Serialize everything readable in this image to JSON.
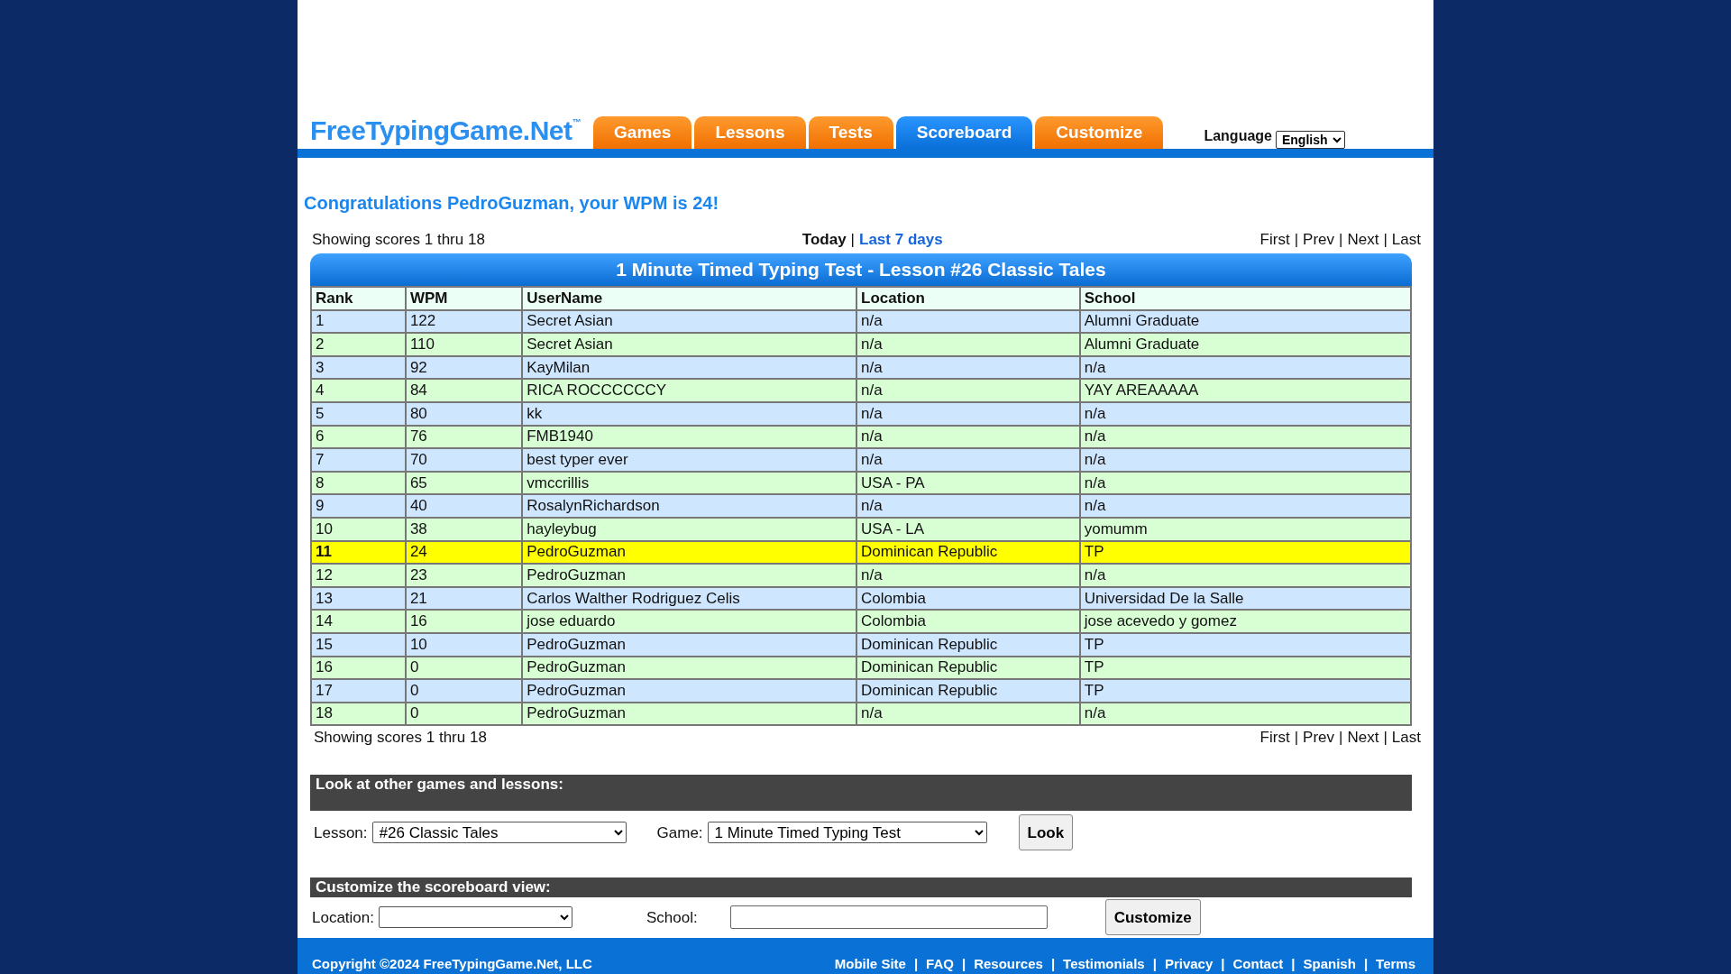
{
  "header": {
    "logo": "FreeTypingGame.Net$^{™}$",
    "tabs": [
      {
        "label": "Games",
        "selected": false
      },
      {
        "label": "Lessons",
        "selected": false
      },
      {
        "label": "Tests",
        "selected": false
      },
      {
        "label": "Scoreboard",
        "selected": true
      },
      {
        "label": "Customize",
        "selected": false
      }
    ],
    "language": {
      "label": "Language",
      "value": "English"
    }
  },
  "congrats": "Congratulations PedroGuzman, your WPM is 24!",
  "scoreboard": {
    "showing_top": "Showing scores 1 thru 18",
    "periods": [
      {
        "label": "Today",
        "selected": true
      },
      {
        "label": "Last 7 days",
        "selected": false
      }
    ],
    "separator": "|",
    "pager_top": [
      "First",
      "Prev",
      "Next",
      "Last"
    ],
    "title": "1 Minute Timed Typing Test - Lesson #26 Classic Tales",
    "columns": [
      "Rank",
      "WPM",
      "UserName",
      "Location",
      "School"
    ],
    "rows": [
      {
        "cells": [
          "1",
          "122",
          "Secret Asian",
          "n/a",
          "Alumni Graduate"
        ],
        "selected": false
      },
      {
        "cells": [
          "2",
          "110",
          "Secret Asian",
          "n/a",
          "Alumni Graduate"
        ],
        "selected": false
      },
      {
        "cells": [
          "3",
          "92",
          "KayMilan",
          "n/a",
          "n/a"
        ],
        "selected": false
      },
      {
        "cells": [
          "4",
          "84",
          "RICA ROCCCCCCY",
          "n/a",
          "YAY AREAAAAA"
        ],
        "selected": false
      },
      {
        "cells": [
          "5",
          "80",
          "kk",
          "n/a",
          "n/a"
        ],
        "selected": false
      },
      {
        "cells": [
          "6",
          "76",
          "FMB1940",
          "n/a",
          "n/a"
        ],
        "selected": false
      },
      {
        "cells": [
          "7",
          "70",
          "best typer ever",
          "n/a",
          "n/a"
        ],
        "selected": false
      },
      {
        "cells": [
          "8",
          "65",
          "vmccrillis",
          "USA - PA",
          "n/a"
        ],
        "selected": false
      },
      {
        "cells": [
          "9",
          "40",
          "RosalynRichardson",
          "n/a",
          "n/a"
        ],
        "selected": false
      },
      {
        "cells": [
          "10",
          "38",
          "hayleybug",
          "USA - LA",
          "yomumm"
        ],
        "selected": false
      },
      {
        "cells": [
          "11",
          "24",
          "PedroGuzman",
          "Dominican Republic",
          "TP"
        ],
        "selected": true
      },
      {
        "cells": [
          "12",
          "23",
          "PedroGuzman",
          "n/a",
          "n/a"
        ],
        "selected": false
      },
      {
        "cells": [
          "13",
          "21",
          "Carlos Walther Rodriguez Celis",
          "Colombia",
          "Universidad De la Salle"
        ],
        "selected": false
      },
      {
        "cells": [
          "14",
          "16",
          "jose eduardo",
          "Colombia",
          "jose acevedo y gomez"
        ],
        "selected": false
      },
      {
        "cells": [
          "15",
          "10",
          "PedroGuzman",
          "Dominican Republic",
          "TP"
        ],
        "selected": false
      },
      {
        "cells": [
          "16",
          "0",
          "PedroGuzman",
          "Dominican Republic",
          "TP"
        ],
        "selected": false
      },
      {
        "cells": [
          "17",
          "0",
          "PedroGuzman",
          "Dominican Republic",
          "TP"
        ],
        "selected": false
      },
      {
        "cells": [
          "18",
          "0",
          "PedroGuzman",
          "n/a",
          "n/a"
        ],
        "selected": false
      }
    ],
    "showing_bottom": "Showing scores 1 thru 18",
    "pager_bottom": [
      "First",
      "Prev",
      "Next",
      "Last"
    ]
  },
  "look": {
    "heading": "Look at other games and lessons:",
    "lesson_label": "Lesson:",
    "lesson_value": "#26 Classic Tales",
    "game_label": "Game:",
    "game_value": "1 Minute Timed Typing Test",
    "button": "Look"
  },
  "customize": {
    "heading": "Customize the scoreboard view:",
    "location_label": "Location:",
    "school_label": "School:",
    "button": "Customize"
  },
  "footer": {
    "copyright": "Copyright ©2024 FreeTypingGame.Net, LLC",
    "separator": "|",
    "links": [
      "Mobile Site",
      "FAQ",
      "Resources",
      "Testimonials",
      "Privacy",
      "Contact",
      "Spanish",
      "Terms"
    ]
  }
}
